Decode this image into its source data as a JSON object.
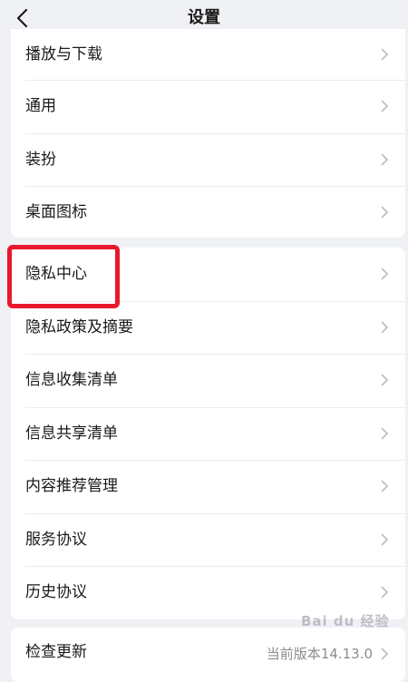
{
  "header": {
    "title": "设置",
    "back_icon": "chevron-left-icon"
  },
  "group1": {
    "items": [
      {
        "label": "播放与下载"
      },
      {
        "label": "通用"
      },
      {
        "label": "装扮"
      },
      {
        "label": "桌面图标"
      }
    ]
  },
  "group2": {
    "items": [
      {
        "label": "隐私中心"
      },
      {
        "label": "隐私政策及摘要"
      },
      {
        "label": "信息收集清单"
      },
      {
        "label": "信息共享清单"
      },
      {
        "label": "内容推荐管理"
      },
      {
        "label": "服务协议"
      },
      {
        "label": "历史协议"
      }
    ]
  },
  "group3": {
    "items": [
      {
        "label": "检查更新",
        "value": "当前版本14.13.0"
      }
    ]
  },
  "annotation": {
    "highlight_color": "#e8192c"
  },
  "watermark": {
    "text": "Bai du 经验"
  },
  "colors": {
    "background": "#f0f1f5",
    "card": "#ffffff",
    "chevron": "#b5b5b5"
  }
}
